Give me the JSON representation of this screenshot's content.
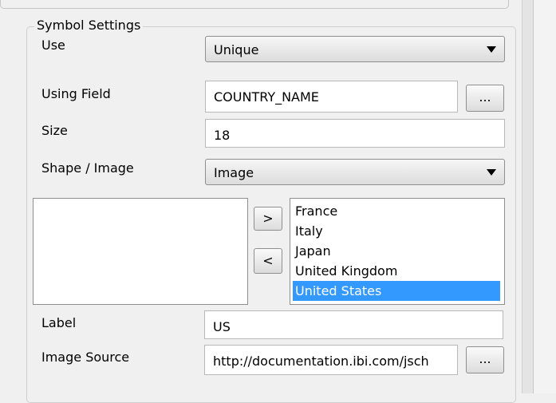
{
  "group_title": "Symbol Settings",
  "use": {
    "label": "Use",
    "value": "Unique"
  },
  "using_field": {
    "label": "Using Field",
    "value": "COUNTRY_NAME",
    "browse": "..."
  },
  "size": {
    "label": "Size",
    "value": "18"
  },
  "shape_image": {
    "label": "Shape / Image",
    "value": "Image"
  },
  "transfer": {
    "add": ">",
    "remove": "<"
  },
  "available_list": [],
  "selected_list": [
    "France",
    "Italy",
    "Japan",
    "United Kingdom",
    "United States"
  ],
  "selected_index": 4,
  "label_field": {
    "label": "Label",
    "value": "US"
  },
  "image_source": {
    "label": "Image Source",
    "value": "http://documentation.ibi.com/jsch",
    "browse": "..."
  },
  "colors": {
    "selection": "#3399ff"
  }
}
